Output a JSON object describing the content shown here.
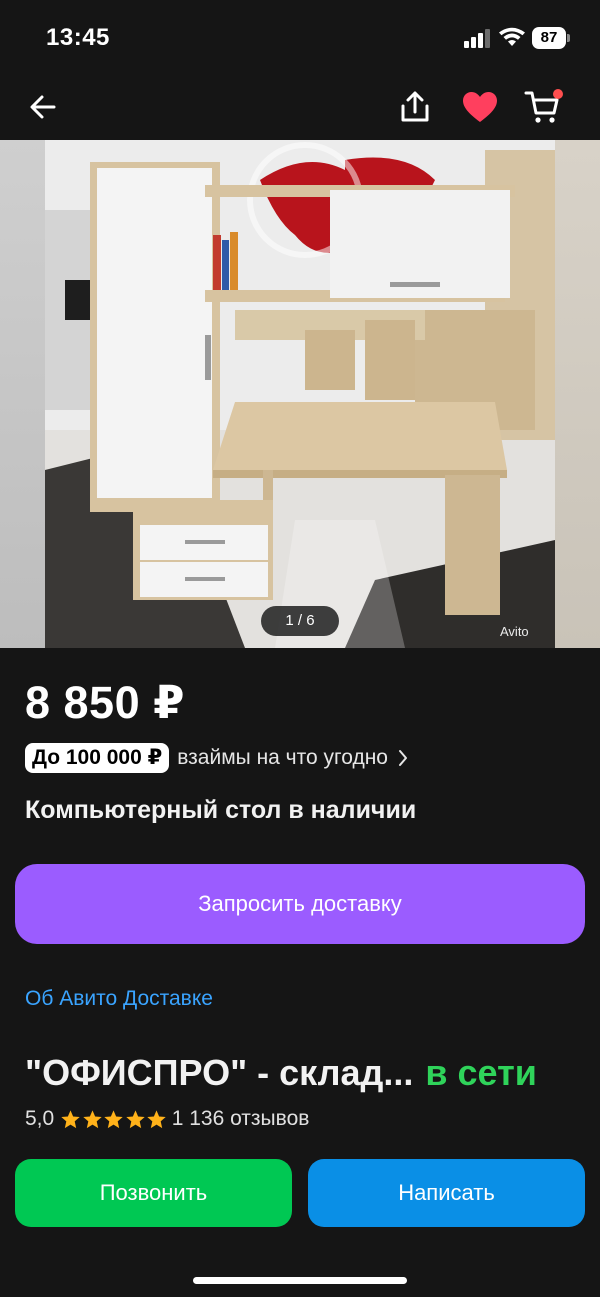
{
  "status_bar": {
    "time": "13:45",
    "battery": "87",
    "icons": [
      "signal-icon",
      "wifi-icon",
      "battery-icon"
    ]
  },
  "nav": {
    "icons": [
      "back-arrow-icon",
      "share-icon",
      "heart-icon",
      "cart-icon"
    ],
    "favorite_color": "#ff3f5e",
    "cart_badge_color": "#ff4f4f"
  },
  "gallery": {
    "counter": "1 / 6",
    "watermark": "Avito"
  },
  "listing": {
    "price": "8 850 ₽",
    "loan_badge": "До 100 000 ₽",
    "loan_text": "взаймы на что угодно",
    "title": "Компьютерный стол в наличии"
  },
  "actions": {
    "delivery_button": "Запросить доставку",
    "delivery_color": "#9b5cff",
    "about_link": "Об Авито Доставке"
  },
  "seller": {
    "name": "\"ОФИСПРО\" - склад...",
    "status": "в сети",
    "rating": "5,0",
    "stars": 5,
    "reviews": "1 136 отзывов"
  },
  "contact": {
    "call_button": "Позвонить",
    "write_button": "Написать",
    "call_color": "#00c853",
    "write_color": "#0a8fe6"
  }
}
